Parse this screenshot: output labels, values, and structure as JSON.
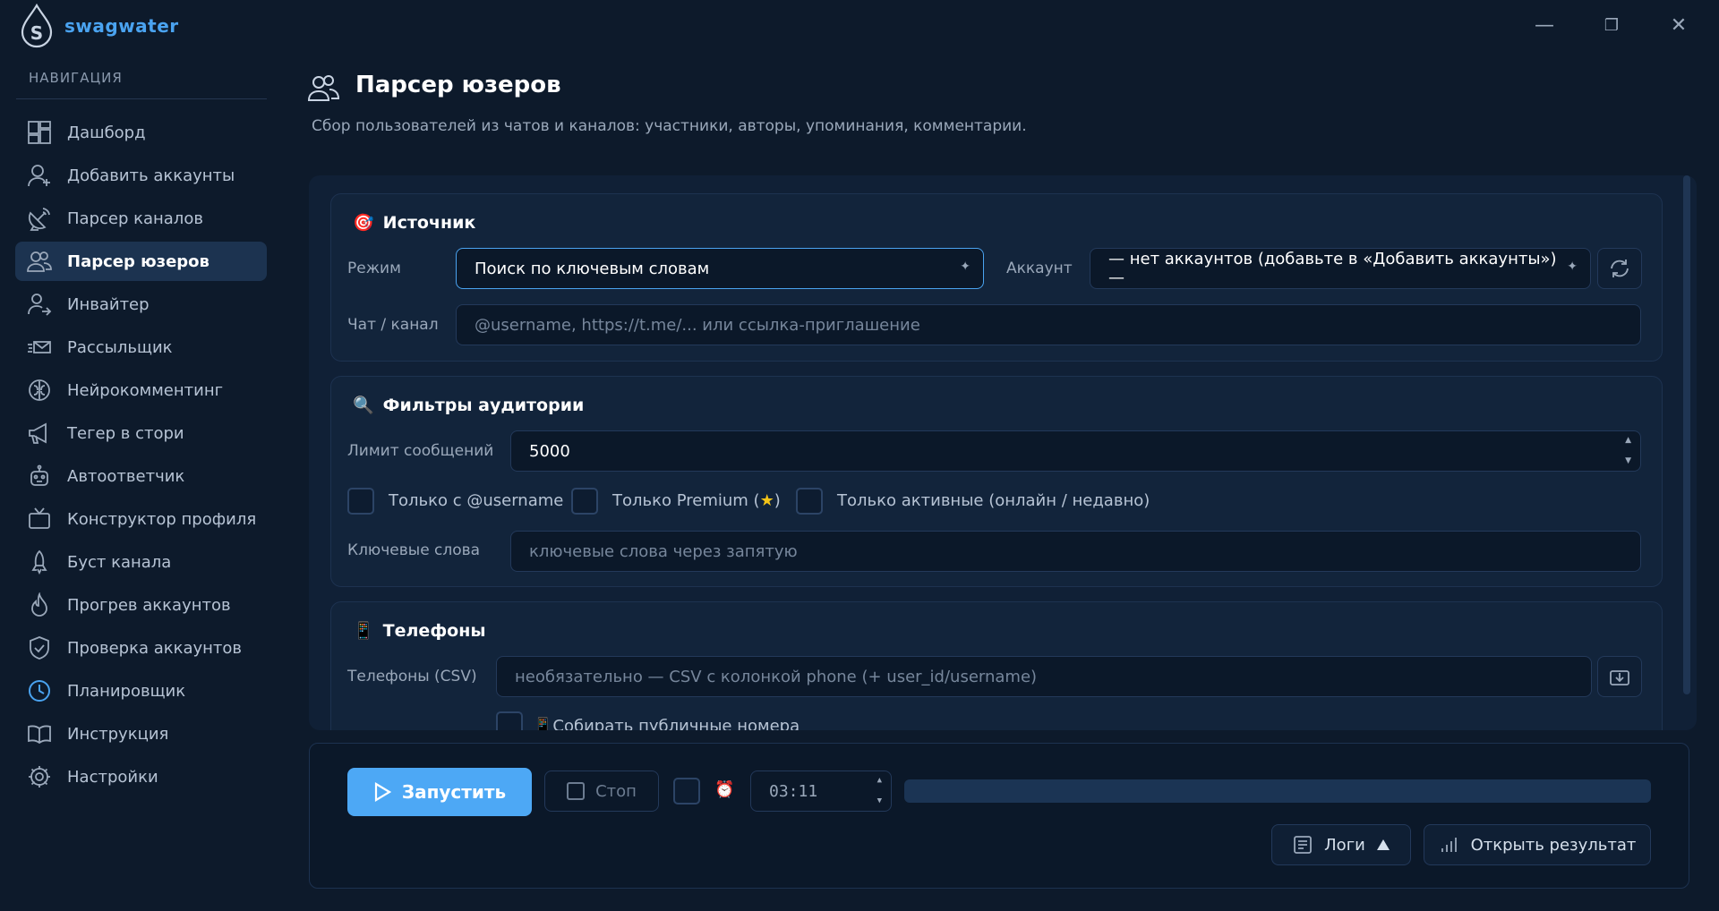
{
  "app": {
    "brand": "swagwater"
  },
  "window": {
    "minimize": "—",
    "maximize": "❐",
    "close": "✕"
  },
  "sidebar": {
    "title": "НАВИГАЦИЯ",
    "items": [
      {
        "label": "Дашборд",
        "icon": "dashboard-icon"
      },
      {
        "label": "Добавить аккаунты",
        "icon": "user-plus-icon"
      },
      {
        "label": "Парсер каналов",
        "icon": "antenna-icon"
      },
      {
        "label": "Парсер юзеров",
        "icon": "users-icon",
        "active": true
      },
      {
        "label": "Инвайтер",
        "icon": "user-arrow-icon"
      },
      {
        "label": "Рассыльщик",
        "icon": "mail-send-icon"
      },
      {
        "label": "Нейрокомментинг",
        "icon": "brain-icon"
      },
      {
        "label": "Тегер в стори",
        "icon": "megaphone-icon"
      },
      {
        "label": "Автоответчик",
        "icon": "robot-icon"
      },
      {
        "label": "Конструктор профиля",
        "icon": "tv-icon"
      },
      {
        "label": "Буст канала",
        "icon": "rocket-icon"
      },
      {
        "label": "Прогрев аккаунтов",
        "icon": "flame-icon"
      },
      {
        "label": "Проверка аккаунтов",
        "icon": "shield-check-icon"
      },
      {
        "label": "Планировщик",
        "icon": "clock-icon"
      },
      {
        "label": "Инструкция",
        "icon": "book-icon"
      },
      {
        "label": "Настройки",
        "icon": "gear-icon"
      }
    ]
  },
  "page": {
    "title": "Парсер юзеров",
    "subtitle": "Сбор пользователей из чатов и каналов: участники, авторы, упоминания, комментарии."
  },
  "source": {
    "title": "Источник",
    "icon": "🎯",
    "mode_label": "Режим",
    "mode_value": "Поиск по ключевым словам",
    "account_label": "Аккаунт",
    "account_value": "— нет аккаунтов (добавьте в «Добавить аккаунты») —",
    "chat_label": "Чат / канал",
    "chat_placeholder": "@username, https://t.me/... или ссылка-приглашение"
  },
  "filters": {
    "title": "Фильтры аудитории",
    "icon": "🔍",
    "limit_label": "Лимит сообщений",
    "limit_value": "5000",
    "only_username": "Только с @username",
    "only_premium": "Только Premium (",
    "star": "★",
    "premium_close": ")",
    "only_active": "Только активные (онлайн / недавно)",
    "keywords_label": "Ключевые слова",
    "keywords_placeholder": "ключевые слова через запятую"
  },
  "phones": {
    "title": "Телефоны",
    "icon": "📱",
    "csv_label": "Телефоны (CSV)",
    "csv_placeholder": "необязательно — CSV с колонкой phone (+ user_id/username)",
    "collect_label": "Собирать публичные номера",
    "collect_icon": "📱"
  },
  "controls": {
    "run": "Запустить",
    "stop": "Стоп",
    "alarm_icon": "⏰",
    "time_value": "03:11",
    "progress": 0,
    "logs": "Логи",
    "open_result": "Открыть результат"
  },
  "colors": {
    "accent": "#4da8f5",
    "bg": "#0d1a2b",
    "card": "#12243b"
  }
}
